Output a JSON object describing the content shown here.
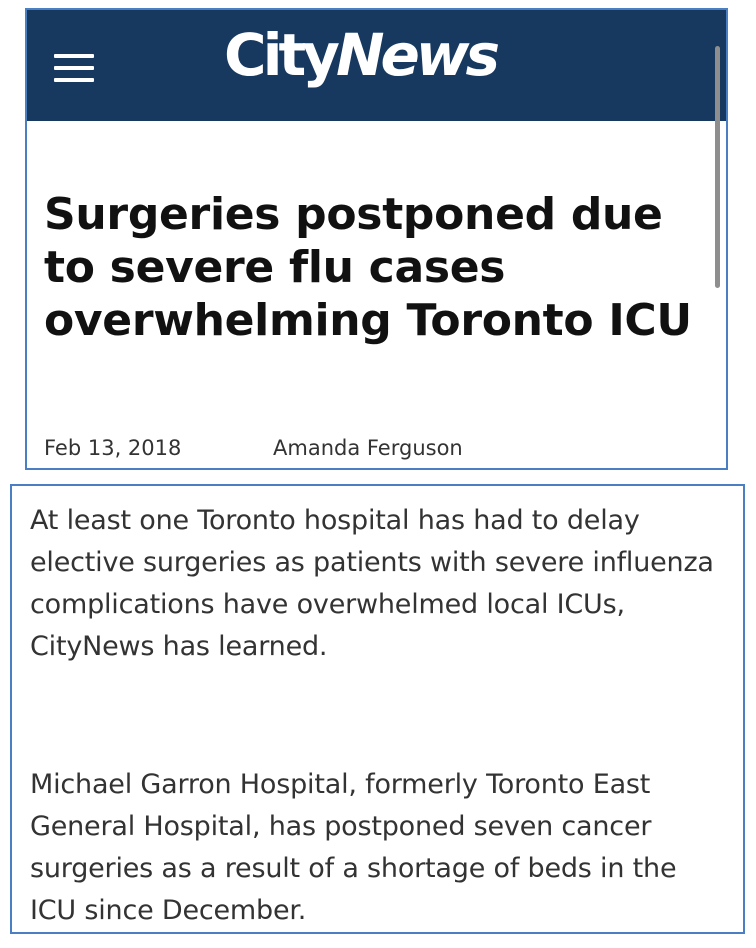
{
  "header": {
    "menu_icon": "hamburger-menu-icon",
    "logo_city": "City",
    "logo_news": "News",
    "background_color": "#17385f"
  },
  "article": {
    "headline": "Surgeries postponed due to severe flu cases overwhelming Toronto ICU",
    "date": "Feb 13, 2018",
    "author": "Amanda Ferguson",
    "paragraphs": [
      "At least one Toronto hospital has had to delay elective surgeries as patients with severe influenza complications have overwhelmed local ICUs, CityNews has learned.",
      "Michael Garron Hospital, formerly Toronto East General Hospital, has postponed seven cancer surgeries as a result of a shortage of beds in the ICU since December."
    ]
  },
  "colors": {
    "border": "#4a7fc4",
    "headline_text": "#111111",
    "body_text": "#333333"
  }
}
